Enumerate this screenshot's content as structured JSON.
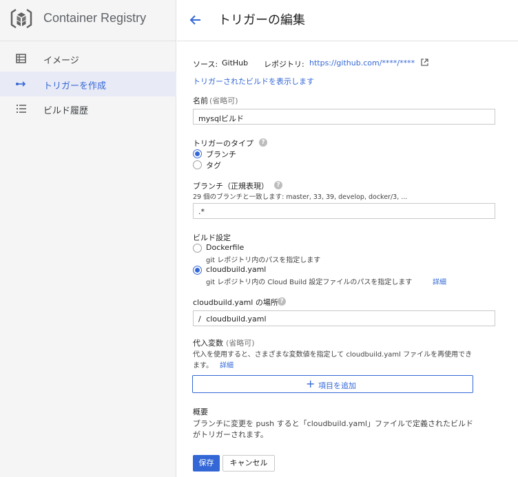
{
  "app": {
    "title": "Container Registry"
  },
  "sidebar": {
    "items": [
      {
        "label": "イメージ",
        "icon": "list-table-icon",
        "active": false
      },
      {
        "label": "トリガーを作成",
        "icon": "trigger-arrows-icon",
        "active": true
      },
      {
        "label": "ビルド履歴",
        "icon": "history-list-icon",
        "active": false
      }
    ]
  },
  "header": {
    "title": "トリガーの編集"
  },
  "source": {
    "source_label": "ソース:",
    "source_value": "GitHub",
    "repo_label": "レポジトリ:",
    "repo_url": "https://github.com/****/****",
    "view_builds_link": "トリガーされたビルドを表示します"
  },
  "name_field": {
    "label": "名前",
    "optional": "(省略可)",
    "value": "mysqlビルド"
  },
  "trigger_type": {
    "label": "トリガーのタイプ",
    "options": [
      "ブランチ",
      "タグ"
    ],
    "selected": "ブランチ"
  },
  "branch": {
    "label": "ブランチ（正規表現）",
    "hint": "29 個のブランチと一致します: master, 33, 39, develop, docker/3, ...",
    "value": ".*"
  },
  "build_config": {
    "label": "ビルド設定",
    "options": [
      {
        "label": "Dockerfile",
        "desc": "git レポジトリ内のパスを指定します"
      },
      {
        "label": "cloudbuild.yaml",
        "desc": "git レポジトリ内の Cloud Build 設定ファイルのパスを指定します"
      }
    ],
    "selected": "cloudbuild.yaml",
    "details_link": "詳細"
  },
  "location": {
    "label": "cloudbuild.yaml の場所",
    "prefix": "/",
    "value": "cloudbuild.yaml"
  },
  "substitutions": {
    "label": "代入変数",
    "optional": "(省略可)",
    "desc_line1": "代入を使用すると、さまざまな変数値を指定して cloudbuild.yaml ファイルを再使用でき",
    "desc_line2": "ます。",
    "details_link": "詳細",
    "add_button": "項目を追加"
  },
  "summary": {
    "label": "概要",
    "line1": "ブランチに変更を push すると「cloudbuild.yaml」ファイルで定義されたビルド",
    "line2": "がトリガーされます。"
  },
  "actions": {
    "save": "保存",
    "cancel": "キャンセル"
  },
  "colors": {
    "accent": "#3367d6",
    "sidebar_bg": "#f5f5f5",
    "active_bg": "#e8eaf6"
  }
}
